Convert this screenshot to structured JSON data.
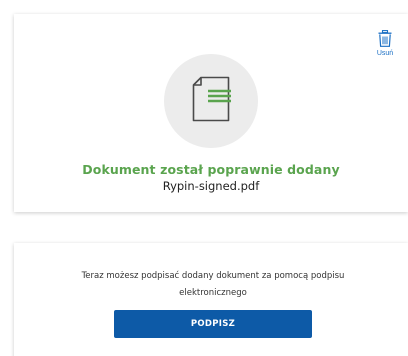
{
  "upload_card": {
    "delete_label": "Usuń",
    "delete_icon": "trash-icon",
    "document_icon": "document-icon",
    "success_message": "Dokument został poprawnie dodany",
    "file_name": "Rypin-signed.pdf"
  },
  "sign_card": {
    "info_text": "Teraz możesz podpisać dodany dokument za pomocą podpisu elektronicznego",
    "sign_button_label": "PODPISZ"
  },
  "colors": {
    "success_green": "#5aa44e",
    "primary_blue": "#0d5aa7",
    "link_blue": "#1a6fc4",
    "icon_circle": "#ececec"
  }
}
